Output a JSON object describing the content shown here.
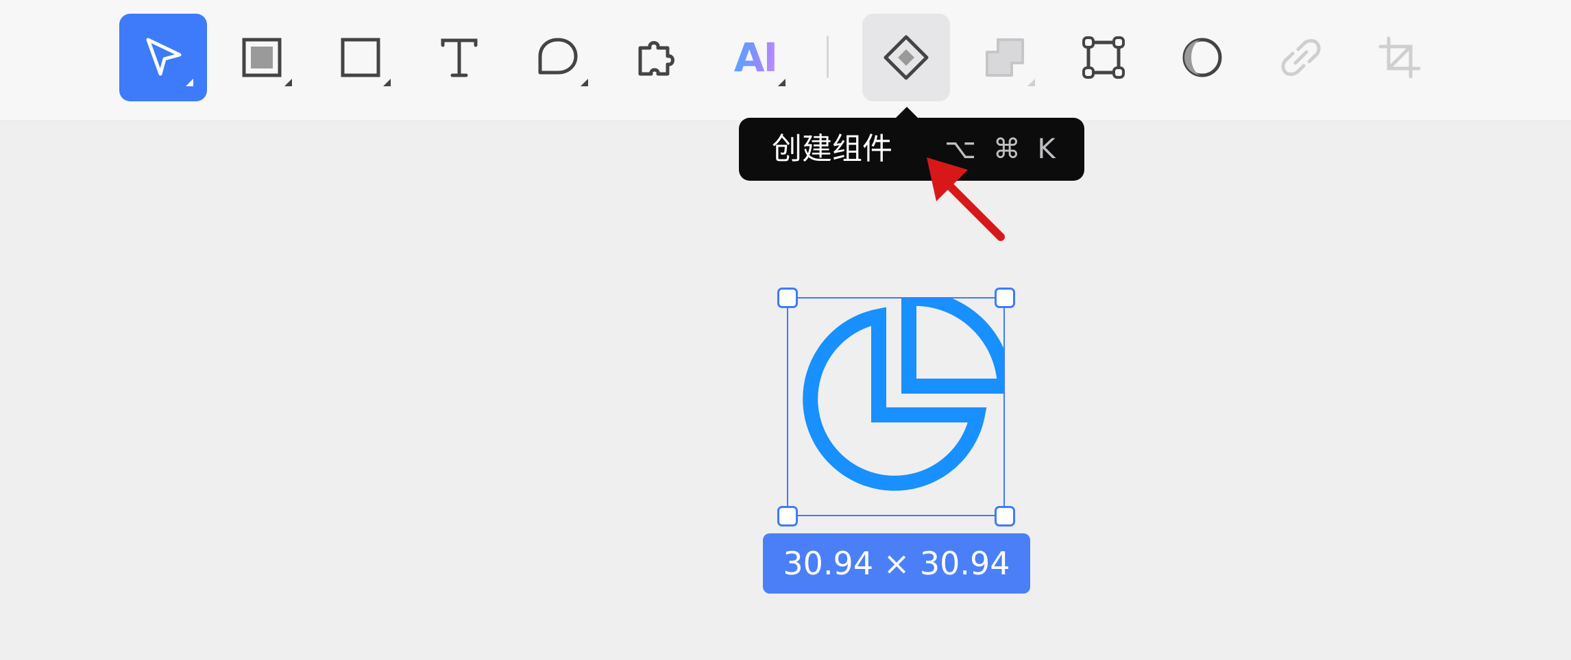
{
  "toolbar": {
    "tools": [
      {
        "name": "move",
        "icon": "cursor-arrow-icon",
        "state": "active"
      },
      {
        "name": "frame",
        "icon": "frame-icon"
      },
      {
        "name": "rectangle",
        "icon": "rectangle-icon"
      },
      {
        "name": "text",
        "icon": "text-icon"
      },
      {
        "name": "comment",
        "icon": "comment-bubble-icon"
      },
      {
        "name": "plugins",
        "icon": "puzzle-piece-icon"
      },
      {
        "name": "ai",
        "icon": "ai-icon",
        "label": "AI"
      },
      {
        "name": "create-component",
        "icon": "component-diamond-icon",
        "state": "hovered"
      },
      {
        "name": "boolean",
        "icon": "boolean-shapes-icon",
        "state": "disabled"
      },
      {
        "name": "edit-vector",
        "icon": "vector-edit-icon"
      },
      {
        "name": "mask",
        "icon": "mask-icon"
      },
      {
        "name": "link",
        "icon": "link-icon",
        "state": "disabled"
      },
      {
        "name": "crop",
        "icon": "crop-icon",
        "state": "disabled"
      }
    ]
  },
  "tooltip": {
    "label": "创建组件",
    "shortcut": "⌥ ⌘ K"
  },
  "canvas": {
    "selected_icon": "pie-chart-icon",
    "size_label": "30.94 × 30.94"
  },
  "colors": {
    "accent": "#3d7bfa",
    "icon_blue": "#1890ff",
    "annotation_arrow": "#d81818",
    "tooltip_bg": "#0c0c0d",
    "canvas_bg": "#efeff0",
    "toolbar_bg": "#f7f7f8"
  }
}
